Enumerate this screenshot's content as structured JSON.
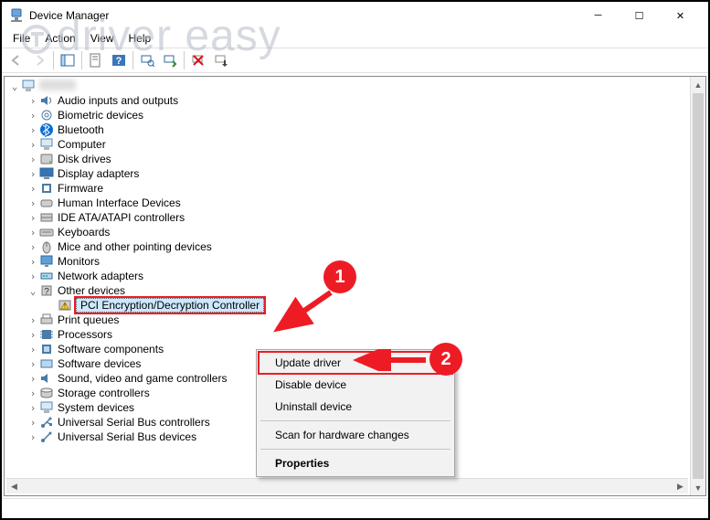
{
  "watermark": "driver easy",
  "window": {
    "title": "Device Manager"
  },
  "menu": {
    "file": "File",
    "action": "Action",
    "view": "View",
    "help": "Help"
  },
  "root": {
    "label": ""
  },
  "tree": [
    {
      "icon": "audio",
      "label": "Audio inputs and outputs"
    },
    {
      "icon": "biometric",
      "label": "Biometric devices"
    },
    {
      "icon": "bluetooth",
      "label": "Bluetooth"
    },
    {
      "icon": "computer",
      "label": "Computer"
    },
    {
      "icon": "disk",
      "label": "Disk drives"
    },
    {
      "icon": "display",
      "label": "Display adapters"
    },
    {
      "icon": "firmware",
      "label": "Firmware"
    },
    {
      "icon": "hid",
      "label": "Human Interface Devices"
    },
    {
      "icon": "ide",
      "label": "IDE ATA/ATAPI controllers"
    },
    {
      "icon": "keyboard",
      "label": "Keyboards"
    },
    {
      "icon": "mouse",
      "label": "Mice and other pointing devices"
    },
    {
      "icon": "monitor",
      "label": "Monitors"
    },
    {
      "icon": "network",
      "label": "Network adapters"
    },
    {
      "icon": "other",
      "label": "Other devices",
      "expanded": true
    },
    {
      "icon": "printqueue",
      "label": "Print queues"
    },
    {
      "icon": "processor",
      "label": "Processors"
    },
    {
      "icon": "softcomp",
      "label": "Software components"
    },
    {
      "icon": "softdev",
      "label": "Software devices"
    },
    {
      "icon": "sound",
      "label": "Sound, video and game controllers"
    },
    {
      "icon": "storage",
      "label": "Storage controllers"
    },
    {
      "icon": "system",
      "label": "System devices"
    },
    {
      "icon": "usbctrl",
      "label": "Universal Serial Bus controllers"
    },
    {
      "icon": "usbdev",
      "label": "Universal Serial Bus devices"
    }
  ],
  "selected_item": {
    "label": "PCI Encryption/Decryption Controller"
  },
  "context_menu": {
    "update": "Update driver",
    "disable": "Disable device",
    "uninstall": "Uninstall device",
    "scan": "Scan for hardware changes",
    "properties": "Properties"
  },
  "annotation": {
    "one": "1",
    "two": "2"
  }
}
